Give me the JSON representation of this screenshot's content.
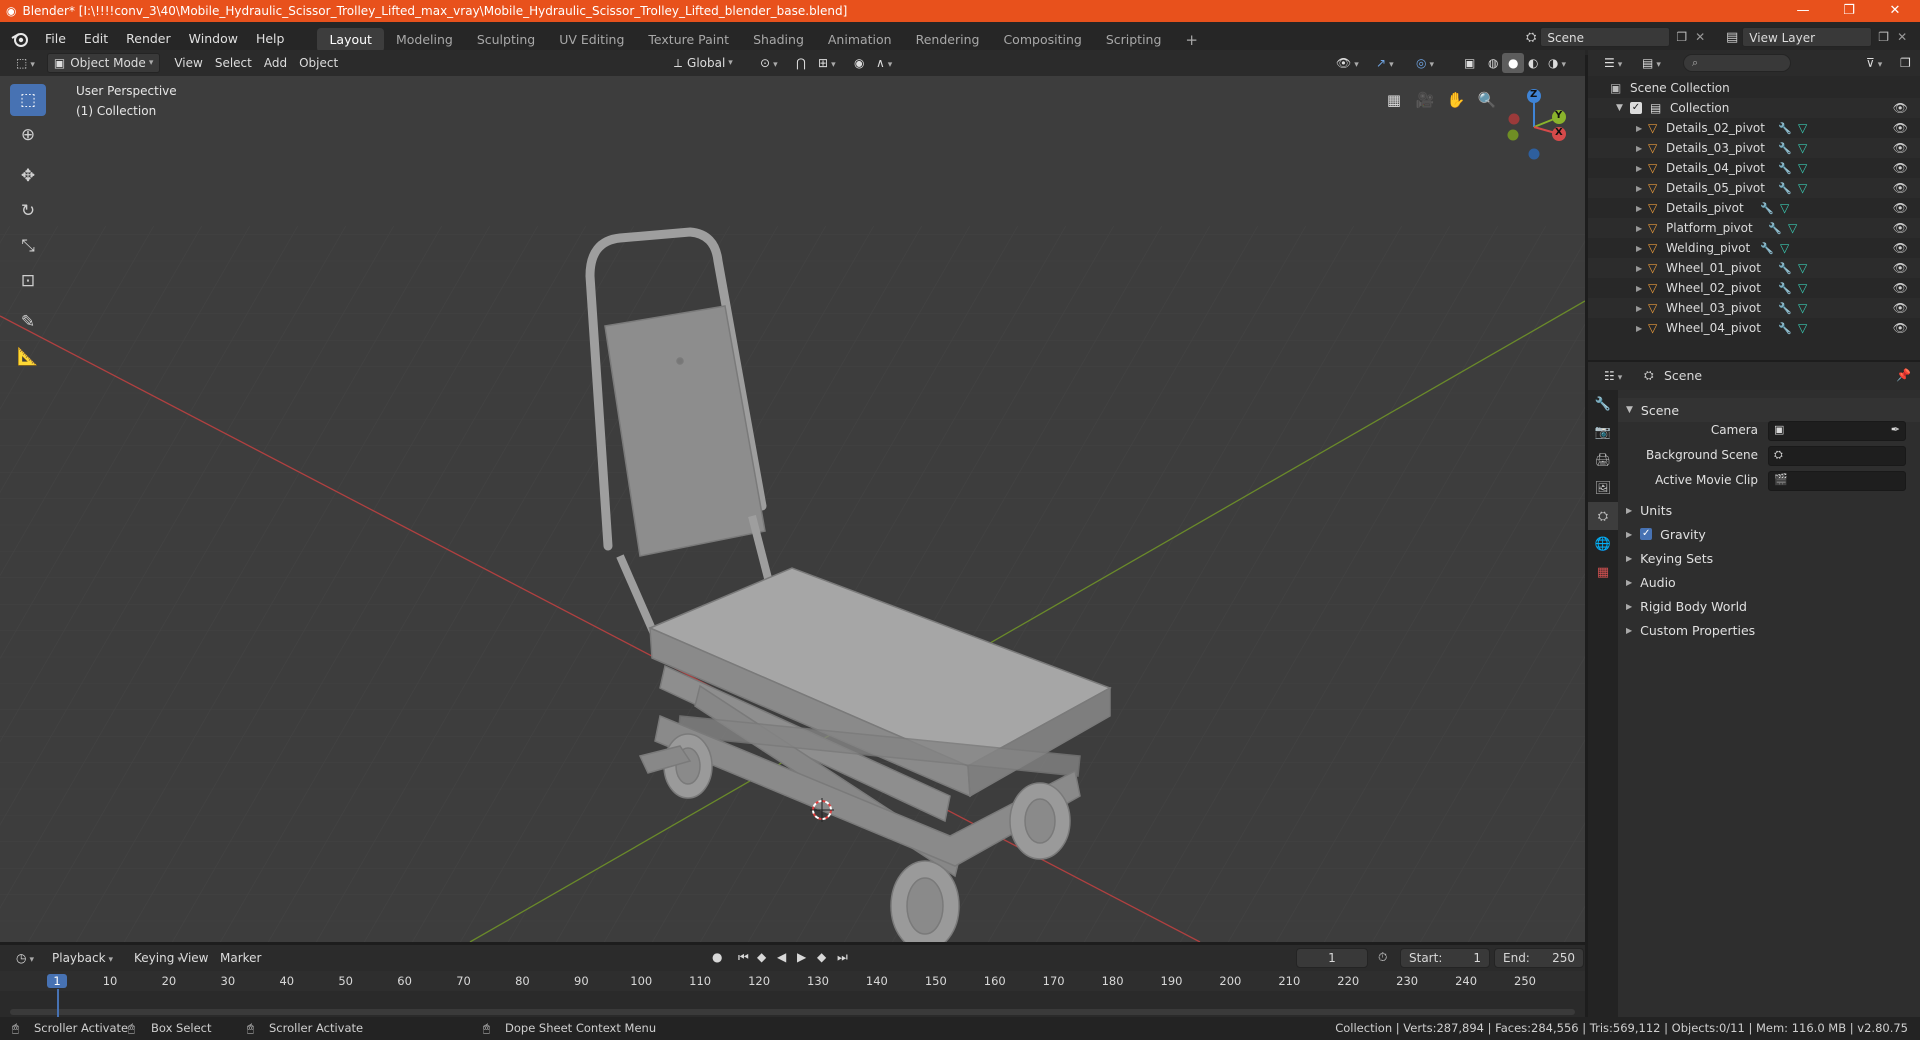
{
  "window": {
    "title": "Blender* [I:\\!!!!conv_3\\40\\Mobile_Hydraulic_Scissor_Trolley_Lifted_max_vray\\Mobile_Hydraulic_Scissor_Trolley_Lifted_blender_base.blend]",
    "minimize": "—",
    "maximize": "❐",
    "close": "✕"
  },
  "menubar": {
    "menus": [
      "File",
      "Edit",
      "Render",
      "Window",
      "Help"
    ],
    "workspaces": [
      "Layout",
      "Modeling",
      "Sculpting",
      "UV Editing",
      "Texture Paint",
      "Shading",
      "Animation",
      "Rendering",
      "Compositing",
      "Scripting"
    ],
    "active_workspace": "Layout",
    "add_tab": "+",
    "scene_value": "Scene",
    "view_layer_value": "View Layer"
  },
  "viewport_header": {
    "mode": "Object Mode",
    "menus": [
      "View",
      "Select",
      "Add",
      "Object"
    ],
    "transform_orientation": "Global"
  },
  "viewport": {
    "perspective_label": "User Perspective",
    "collection_label": "(1) Collection",
    "gizmo_axes": {
      "z": "Z",
      "y": "Y",
      "x": "X"
    },
    "colors": {
      "x_axis": "#d64a4a",
      "y_axis": "#8ab32c",
      "z_axis": "#3f84d6",
      "background": "#3d3d3d",
      "model": "#9c9c9c"
    }
  },
  "outliner": {
    "root": "Scene Collection",
    "collection": "Collection",
    "items": [
      {
        "name": "Details_02_pivot"
      },
      {
        "name": "Details_03_pivot"
      },
      {
        "name": "Details_04_pivot"
      },
      {
        "name": "Details_05_pivot"
      },
      {
        "name": "Details_pivot"
      },
      {
        "name": "Platform_pivot"
      },
      {
        "name": "Welding_pivot"
      },
      {
        "name": "Wheel_01_pivot"
      },
      {
        "name": "Wheel_02_pivot"
      },
      {
        "name": "Wheel_03_pivot"
      },
      {
        "name": "Wheel_04_pivot"
      }
    ]
  },
  "properties": {
    "header_title": "Scene",
    "section_title": "Scene",
    "camera_label": "Camera",
    "background_scene_label": "Background Scene",
    "active_movie_clip_label": "Active Movie Clip",
    "subsections": [
      "Units",
      "Gravity",
      "Keying Sets",
      "Audio",
      "Rigid Body World",
      "Custom Properties"
    ],
    "gravity_checked": true
  },
  "timeline": {
    "menus": [
      "Playback",
      "Keying",
      "View",
      "Marker"
    ],
    "current_frame": "1",
    "start_label": "Start:",
    "start_value": "1",
    "end_label": "End:",
    "end_value": "250",
    "ruler_ticks": [
      "1",
      "10",
      "20",
      "30",
      "40",
      "50",
      "60",
      "70",
      "80",
      "90",
      "100",
      "110",
      "120",
      "130",
      "140",
      "150",
      "160",
      "170",
      "180",
      "190",
      "200",
      "210",
      "220",
      "230",
      "240",
      "250"
    ]
  },
  "statusbar": {
    "left_action_1": "Scroller Activate",
    "left_action_2": "Box Select",
    "left_action_3": "Scroller Activate",
    "left_action_4": "Dope Sheet Context Menu",
    "stats": "Collection | Verts:287,894 | Faces:284,556 | Tris:569,112 | Objects:0/11 | Mem: 116.0 MB | v2.80.75"
  }
}
